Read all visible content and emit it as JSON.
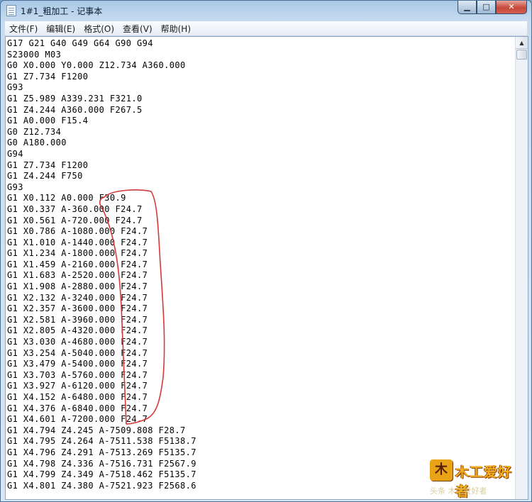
{
  "window": {
    "title": "1#1_粗加工 - 记事本",
    "minimize_glyph": "▁",
    "maximize_glyph": "□",
    "close_glyph": "✕"
  },
  "menu": [
    "文件(F)",
    "编辑(E)",
    "格式(O)",
    "查看(V)",
    "帮助(H)"
  ],
  "editor": {
    "lines": [
      "G17 G21 G40 G49 G64 G90 G94",
      "S23000 M03",
      "G0 X0.000 Y0.000 Z12.734 A360.000",
      "G1 Z7.734 F1200",
      "G93",
      "G1 Z5.989 A339.231 F321.0",
      "G1 Z4.244 A360.000 F267.5",
      "G1 A0.000 F15.4",
      "G0 Z12.734",
      "G0 A180.000",
      "G94",
      "G1 Z7.734 F1200",
      "G1 Z4.244 F750",
      "G93",
      "G1 X0.112 A0.000 F30.9",
      "G1 X0.337 A-360.000 F24.7",
      "G1 X0.561 A-720.000 F24.7",
      "G1 X0.786 A-1080.000 F24.7",
      "G1 X1.010 A-1440.000 F24.7",
      "G1 X1.234 A-1800.000 F24.7",
      "G1 X1.459 A-2160.000 F24.7",
      "G1 X1.683 A-2520.000 F24.7",
      "G1 X1.908 A-2880.000 F24.7",
      "G1 X2.132 A-3240.000 F24.7",
      "G1 X2.357 A-3600.000 F24.7",
      "G1 X2.581 A-3960.000 F24.7",
      "G1 X2.805 A-4320.000 F24.7",
      "G1 X3.030 A-4680.000 F24.7",
      "G1 X3.254 A-5040.000 F24.7",
      "G1 X3.479 A-5400.000 F24.7",
      "G1 X3.703 A-5760.000 F24.7",
      "G1 X3.927 A-6120.000 F24.7",
      "G1 X4.152 A-6480.000 F24.7",
      "G1 X4.376 A-6840.000 F24.7",
      "G1 X4.601 A-7200.000 F24.7",
      "G1 X4.794 Z4.245 A-7509.808 F28.7",
      "G1 X4.795 Z4.264 A-7511.538 F5138.7",
      "G1 X4.796 Z4.291 A-7513.269 F5135.7",
      "G1 X4.798 Z4.336 A-7516.731 F2567.9",
      "G1 X4.799 Z4.349 A-7518.462 F5135.7",
      "G1 X4.801 Z4.380 A-7521.923 F2568.6"
    ]
  },
  "annotation": {
    "color": "#d43a3a"
  },
  "watermark": {
    "logo_text": "木",
    "text": "木工爱好者",
    "sub_text": "头条 木工爱好者"
  }
}
